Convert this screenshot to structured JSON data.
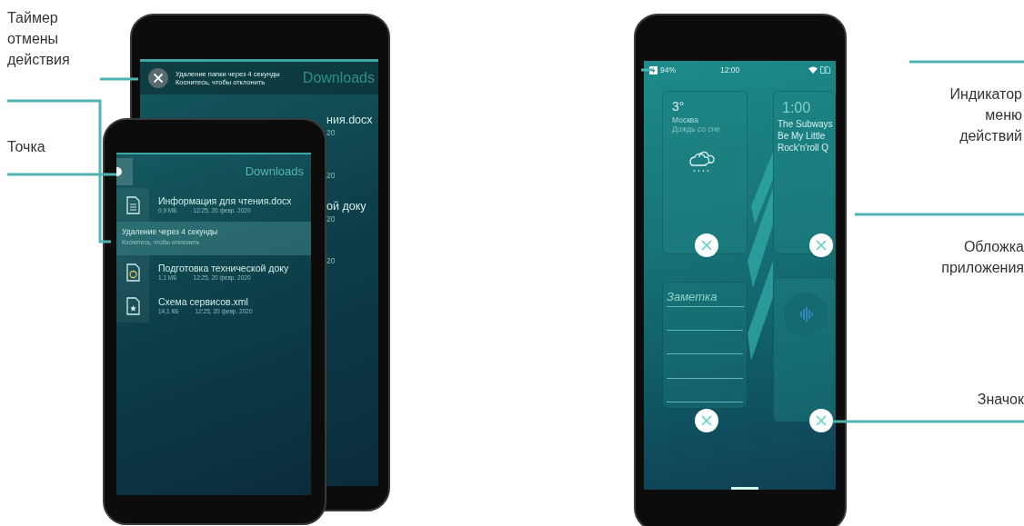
{
  "callouts_left": [
    {
      "text": "Таймер отмены действия"
    },
    {
      "text": "Точка"
    }
  ],
  "back_phone": {
    "banner": {
      "title": "Удаление папки через 4 секунды",
      "hint": "Коснитесь, чтобы отклонить"
    },
    "header": "Downloads",
    "fragments": [
      "ния.docx",
      "20",
      "20",
      "ой доку",
      "20",
      "20"
    ]
  },
  "front_phone": {
    "header": "Downloads",
    "rows": [
      {
        "kind": "file",
        "name": "Информация для чтения.docx",
        "size": "0,9 МБ",
        "date": "12:25, 20 февр. 2020"
      },
      {
        "kind": "remorse",
        "title": "Удаление через 4 секунды",
        "hint": "Коснитесь, чтобы отклонить"
      },
      {
        "kind": "file",
        "name": "Подготовка технической доку",
        "size": "1,1 МБ",
        "date": "12:25, 20 февр. 2020"
      },
      {
        "kind": "file",
        "name": "Схема сервисов.xml",
        "size": "14,1 КБ",
        "date": "12:25, 20 февр. 2020"
      }
    ]
  },
  "right_phone": {
    "status": {
      "battery": "94%",
      "time": "12:00"
    },
    "weather": {
      "temperature": "3°",
      "city": "Москва",
      "condition": "Дождь со сне"
    },
    "music": {
      "time": "1:00",
      "artist": "The Subways",
      "title_lines": [
        "Be My Little",
        "Rock'n'roll Q"
      ]
    },
    "note": {
      "title": "Заметка"
    }
  },
  "callouts_right": [
    {
      "text": "Индикатор меню действий"
    },
    {
      "text": "Обложка приложения"
    },
    {
      "text": "Значок"
    }
  ]
}
